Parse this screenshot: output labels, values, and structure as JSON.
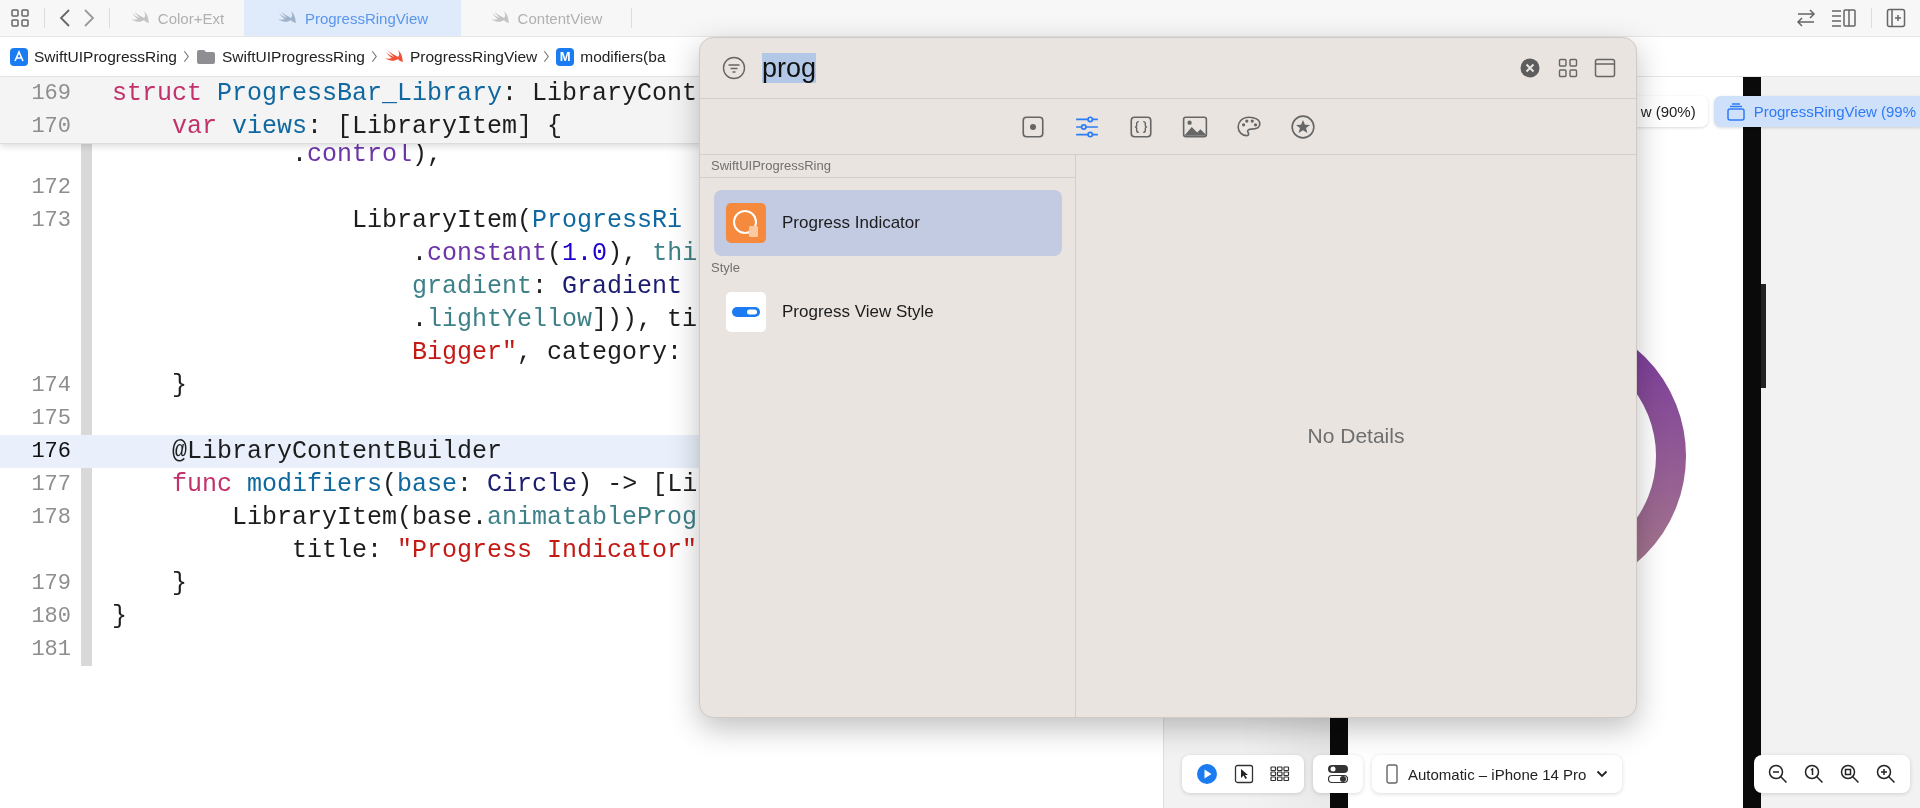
{
  "tabs": [
    {
      "label": "Color+Ext",
      "selected": false
    },
    {
      "label": "ProgressRingView",
      "selected": true
    },
    {
      "label": "ContentView",
      "selected": false
    }
  ],
  "breadcrumb": [
    {
      "kind": "app",
      "label": "SwiftUIProgressRing"
    },
    {
      "kind": "folder",
      "label": "SwiftUIProgressRing"
    },
    {
      "kind": "swift",
      "label": "ProgressRingView"
    },
    {
      "kind": "method",
      "badge": "M",
      "label": "modifiers(ba"
    }
  ],
  "editor": {
    "sticky_lines": [
      {
        "number": "169",
        "tokens": [
          {
            "kind": "keyword",
            "text": "struct "
          },
          {
            "kind": "decl",
            "text": "ProgressBar_Library"
          },
          {
            "kind": "plain",
            "text": ": LibraryCont"
          }
        ]
      },
      {
        "number": "170",
        "tokens": [
          {
            "kind": "keyword",
            "text": "    var "
          },
          {
            "kind": "decl",
            "text": "views"
          },
          {
            "kind": "plain",
            "text": ": [LibraryItem] {"
          }
        ]
      }
    ],
    "lines": [
      {
        "current": false,
        "tokens": [
          {
            "kind": "plain",
            "text": "            ."
          },
          {
            "kind": "member",
            "text": "control"
          },
          {
            "kind": "plain",
            "text": "),"
          }
        ]
      },
      {
        "number": "172",
        "current": false
      },
      {
        "number": "173",
        "current": false,
        "tokens": [
          {
            "kind": "plain",
            "text": "                LibraryItem("
          },
          {
            "kind": "decl",
            "text": "ProgressRi"
          }
        ]
      },
      {
        "current": false,
        "tokens": [
          {
            "kind": "plain",
            "text": "                    ."
          },
          {
            "kind": "member",
            "text": "constant"
          },
          {
            "kind": "plain",
            "text": "("
          },
          {
            "kind": "number",
            "text": "1.0"
          },
          {
            "kind": "plain",
            "text": "), "
          },
          {
            "kind": "property",
            "text": "thi"
          }
        ]
      },
      {
        "current": false,
        "tokens": [
          {
            "kind": "property",
            "text": "                    gradient"
          },
          {
            "kind": "plain",
            "text": ": "
          },
          {
            "kind": "type",
            "text": "Gradient"
          }
        ]
      },
      {
        "current": false,
        "tokens": [
          {
            "kind": "plain",
            "text": "                    ."
          },
          {
            "kind": "property",
            "text": "lightYellow"
          },
          {
            "kind": "plain",
            "text": "])), ti"
          }
        ]
      },
      {
        "current": false,
        "tokens": [
          {
            "kind": "string",
            "text": "                    Bigger\""
          },
          {
            "kind": "plain",
            "text": ", category:"
          }
        ]
      },
      {
        "number": "174",
        "current": false,
        "tokens": [
          {
            "kind": "plain",
            "text": "    }"
          }
        ]
      },
      {
        "number": "175",
        "current": false
      },
      {
        "number": "176",
        "current": true,
        "tokens": [
          {
            "kind": "plain",
            "text": "    @LibraryContentBuilder"
          }
        ]
      },
      {
        "number": "177",
        "current": false,
        "tokens": [
          {
            "kind": "keyword",
            "text": "    func "
          },
          {
            "kind": "decl",
            "text": "modifiers"
          },
          {
            "kind": "plain",
            "text": "("
          },
          {
            "kind": "decl",
            "text": "base"
          },
          {
            "kind": "plain",
            "text": ": "
          },
          {
            "kind": "type",
            "text": "Circle"
          },
          {
            "kind": "plain",
            "text": ") -> [Li"
          }
        ]
      },
      {
        "number": "178",
        "current": false,
        "tokens": [
          {
            "kind": "plain",
            "text": "        LibraryItem(base."
          },
          {
            "kind": "property",
            "text": "animatableProg"
          }
        ]
      },
      {
        "current": false,
        "tokens": [
          {
            "kind": "plain",
            "text": "            title: "
          },
          {
            "kind": "string",
            "text": "\"Progress Indicator\""
          }
        ]
      },
      {
        "number": "179",
        "current": false,
        "tokens": [
          {
            "kind": "plain",
            "text": "    }"
          }
        ]
      },
      {
        "number": "180",
        "current": false,
        "tokens": [
          {
            "kind": "plain",
            "text": "}"
          }
        ]
      },
      {
        "number": "181",
        "current": false
      }
    ]
  },
  "preview": {
    "chips": [
      {
        "label": "w (90%)",
        "selected": false
      },
      {
        "label": "ProgressRingView (99%",
        "selected": true
      }
    ],
    "device": "Automatic – iPhone 14 Pro"
  },
  "library": {
    "search": {
      "value": "prog"
    },
    "categories": [
      {
        "kind": "views",
        "selected": false
      },
      {
        "kind": "modifiers",
        "selected": true
      },
      {
        "kind": "snippets",
        "selected": false
      },
      {
        "kind": "media",
        "selected": false
      },
      {
        "kind": "colors",
        "selected": false
      },
      {
        "kind": "symbols",
        "selected": false
      }
    ],
    "sections": [
      {
        "title": "SwiftUIProgressRing",
        "items": [
          {
            "kind": "indicator",
            "label": "Progress Indicator",
            "selected": true
          }
        ]
      },
      {
        "title": "Style",
        "items": [
          {
            "kind": "style",
            "label": "Progress View Style",
            "selected": false
          }
        ]
      }
    ],
    "detail": "No Details"
  }
}
